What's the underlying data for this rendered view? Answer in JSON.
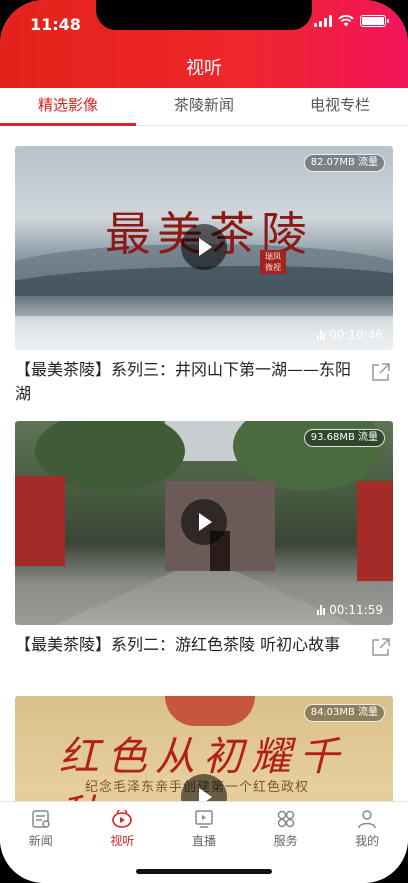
{
  "status_bar": {
    "time": "11:48"
  },
  "header": {
    "title": "视听"
  },
  "tabs": [
    {
      "label": "精选影像",
      "active": true
    },
    {
      "label": "茶陵新闻",
      "active": false
    },
    {
      "label": "电视专栏",
      "active": false
    }
  ],
  "videos": [
    {
      "size": "82.07MB 流量",
      "duration": "00:10:46",
      "title": "【最美茶陵】系列三：井冈山下第一湖——东阳湖",
      "art_text": "最美茶陵",
      "seal_text": "瑞凤 微视"
    },
    {
      "size": "93.68MB 流量",
      "duration": "00:11:59",
      "title": "【最美茶陵】系列二：游红色茶陵 听初心故事"
    },
    {
      "size": "84.03MB 流量",
      "art_text": "红色从初耀千秋",
      "art_sub": "纪念毛泽东亲手创建第一个红色政权"
    }
  ],
  "tabbar": [
    {
      "label": "新闻",
      "icon": "news-icon",
      "active": false
    },
    {
      "label": "视听",
      "icon": "video-icon",
      "active": true
    },
    {
      "label": "直播",
      "icon": "live-icon",
      "active": false
    },
    {
      "label": "服务",
      "icon": "service-icon",
      "active": false
    },
    {
      "label": "我的",
      "icon": "profile-icon",
      "active": false
    }
  ],
  "colors": {
    "accent": "#d8241c",
    "header_start": "#e2231a",
    "header_end": "#f2155a"
  }
}
